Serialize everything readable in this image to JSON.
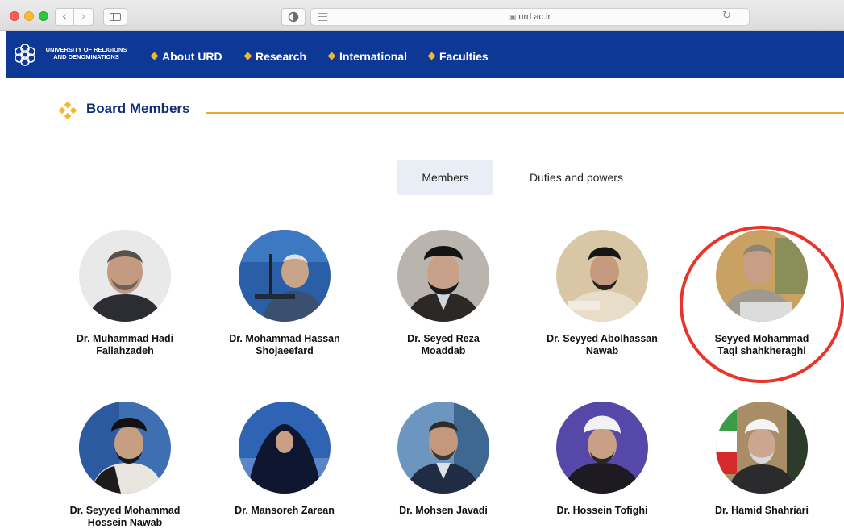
{
  "browser": {
    "url": "urd.ac.ir",
    "icons": [
      "back-icon",
      "forward-icon",
      "sidebar-icon",
      "privacy-icon",
      "reader-icon",
      "lock-icon",
      "reload-icon"
    ]
  },
  "site": {
    "logo_line1": "UNIVERSITY OF RELIGIONS",
    "logo_line2": "AND DENOMINATIONS",
    "nav": [
      {
        "label": "About URD"
      },
      {
        "label": "Research"
      },
      {
        "label": "International"
      },
      {
        "label": "Faculties"
      }
    ],
    "brand_color": "#0d3896",
    "accent_color": "#f2b632"
  },
  "section": {
    "title": "Board Members"
  },
  "tabs": {
    "members": "Members",
    "duties": "Duties and powers",
    "selected": "Members"
  },
  "members": [
    {
      "line1": "Dr. Muhammad Hadi",
      "line2": "Fallahzadeh"
    },
    {
      "line1": "Dr. Mohammad Hassan",
      "line2": "Shojaeefard"
    },
    {
      "line1": "Dr. Seyed Reza",
      "line2": "Moaddab"
    },
    {
      "line1": "Dr. Seyyed Abolhassan",
      "line2": "Nawab"
    },
    {
      "line1": "Seyyed Mohammad",
      "line2": "Taqi shahkheraghi",
      "highlighted": true
    },
    {
      "line1": "Dr. Seyyed Mohammad",
      "line2": "Hossein Nawab"
    },
    {
      "line1": "Dr. Mansoreh Zarean",
      "line2": ""
    },
    {
      "line1": "Dr. Mohsen Javadi",
      "line2": ""
    },
    {
      "line1": "Dr. Hossein Tofighi",
      "line2": ""
    },
    {
      "line1": "Dr. Hamid Shahriari",
      "line2": ""
    }
  ],
  "highlight_color": "#e7352b"
}
